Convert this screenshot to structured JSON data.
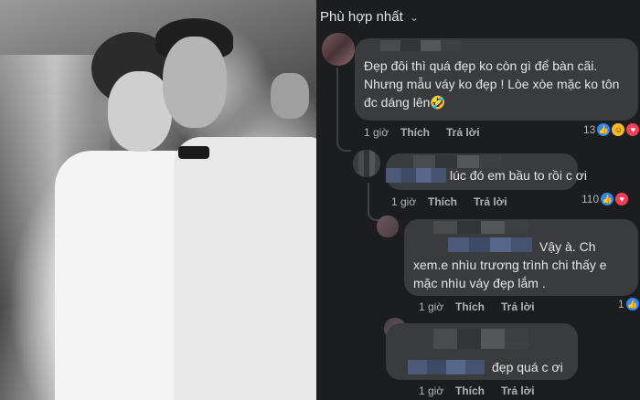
{
  "header": {
    "sort_label": "Phù hợp nhất"
  },
  "comments": [
    {
      "text": "Đẹp đôi thì quá đẹp ko còn gì để bàn cãi. Nhưng mẫu váy ko đẹp ! Lòe xòe mặc ko tôn đc dáng lên🤣",
      "time": "1 giờ",
      "like": "Thích",
      "reply": "Trả lời",
      "reactions": "13"
    },
    {
      "text": "lúc đó em bầu to rồi c ơi",
      "time": "1 giờ",
      "like": "Thích",
      "reply": "Trả lời",
      "reactions": "110"
    },
    {
      "text": "Vậy à. Ch xem.e nhìu trương trình chi thấy e mặc nhìu váy đẹp lắm .",
      "time": "1 giờ",
      "like": "Thích",
      "reply": "Trả lời",
      "reactions": "1"
    },
    {
      "text": "đẹp quá c ơi",
      "time": "1 giờ",
      "like": "Thích",
      "reply": "Trả lời"
    }
  ],
  "colors": {
    "panel_bg": "#1c1d1f",
    "bubble_bg": "#3a3b3c",
    "like_blue": "#2d88ff",
    "haha_yellow": "#f7b928",
    "love_red": "#f33e58"
  },
  "icons": [
    "like-icon",
    "haha-icon",
    "love-icon",
    "chevron-down-icon"
  ]
}
